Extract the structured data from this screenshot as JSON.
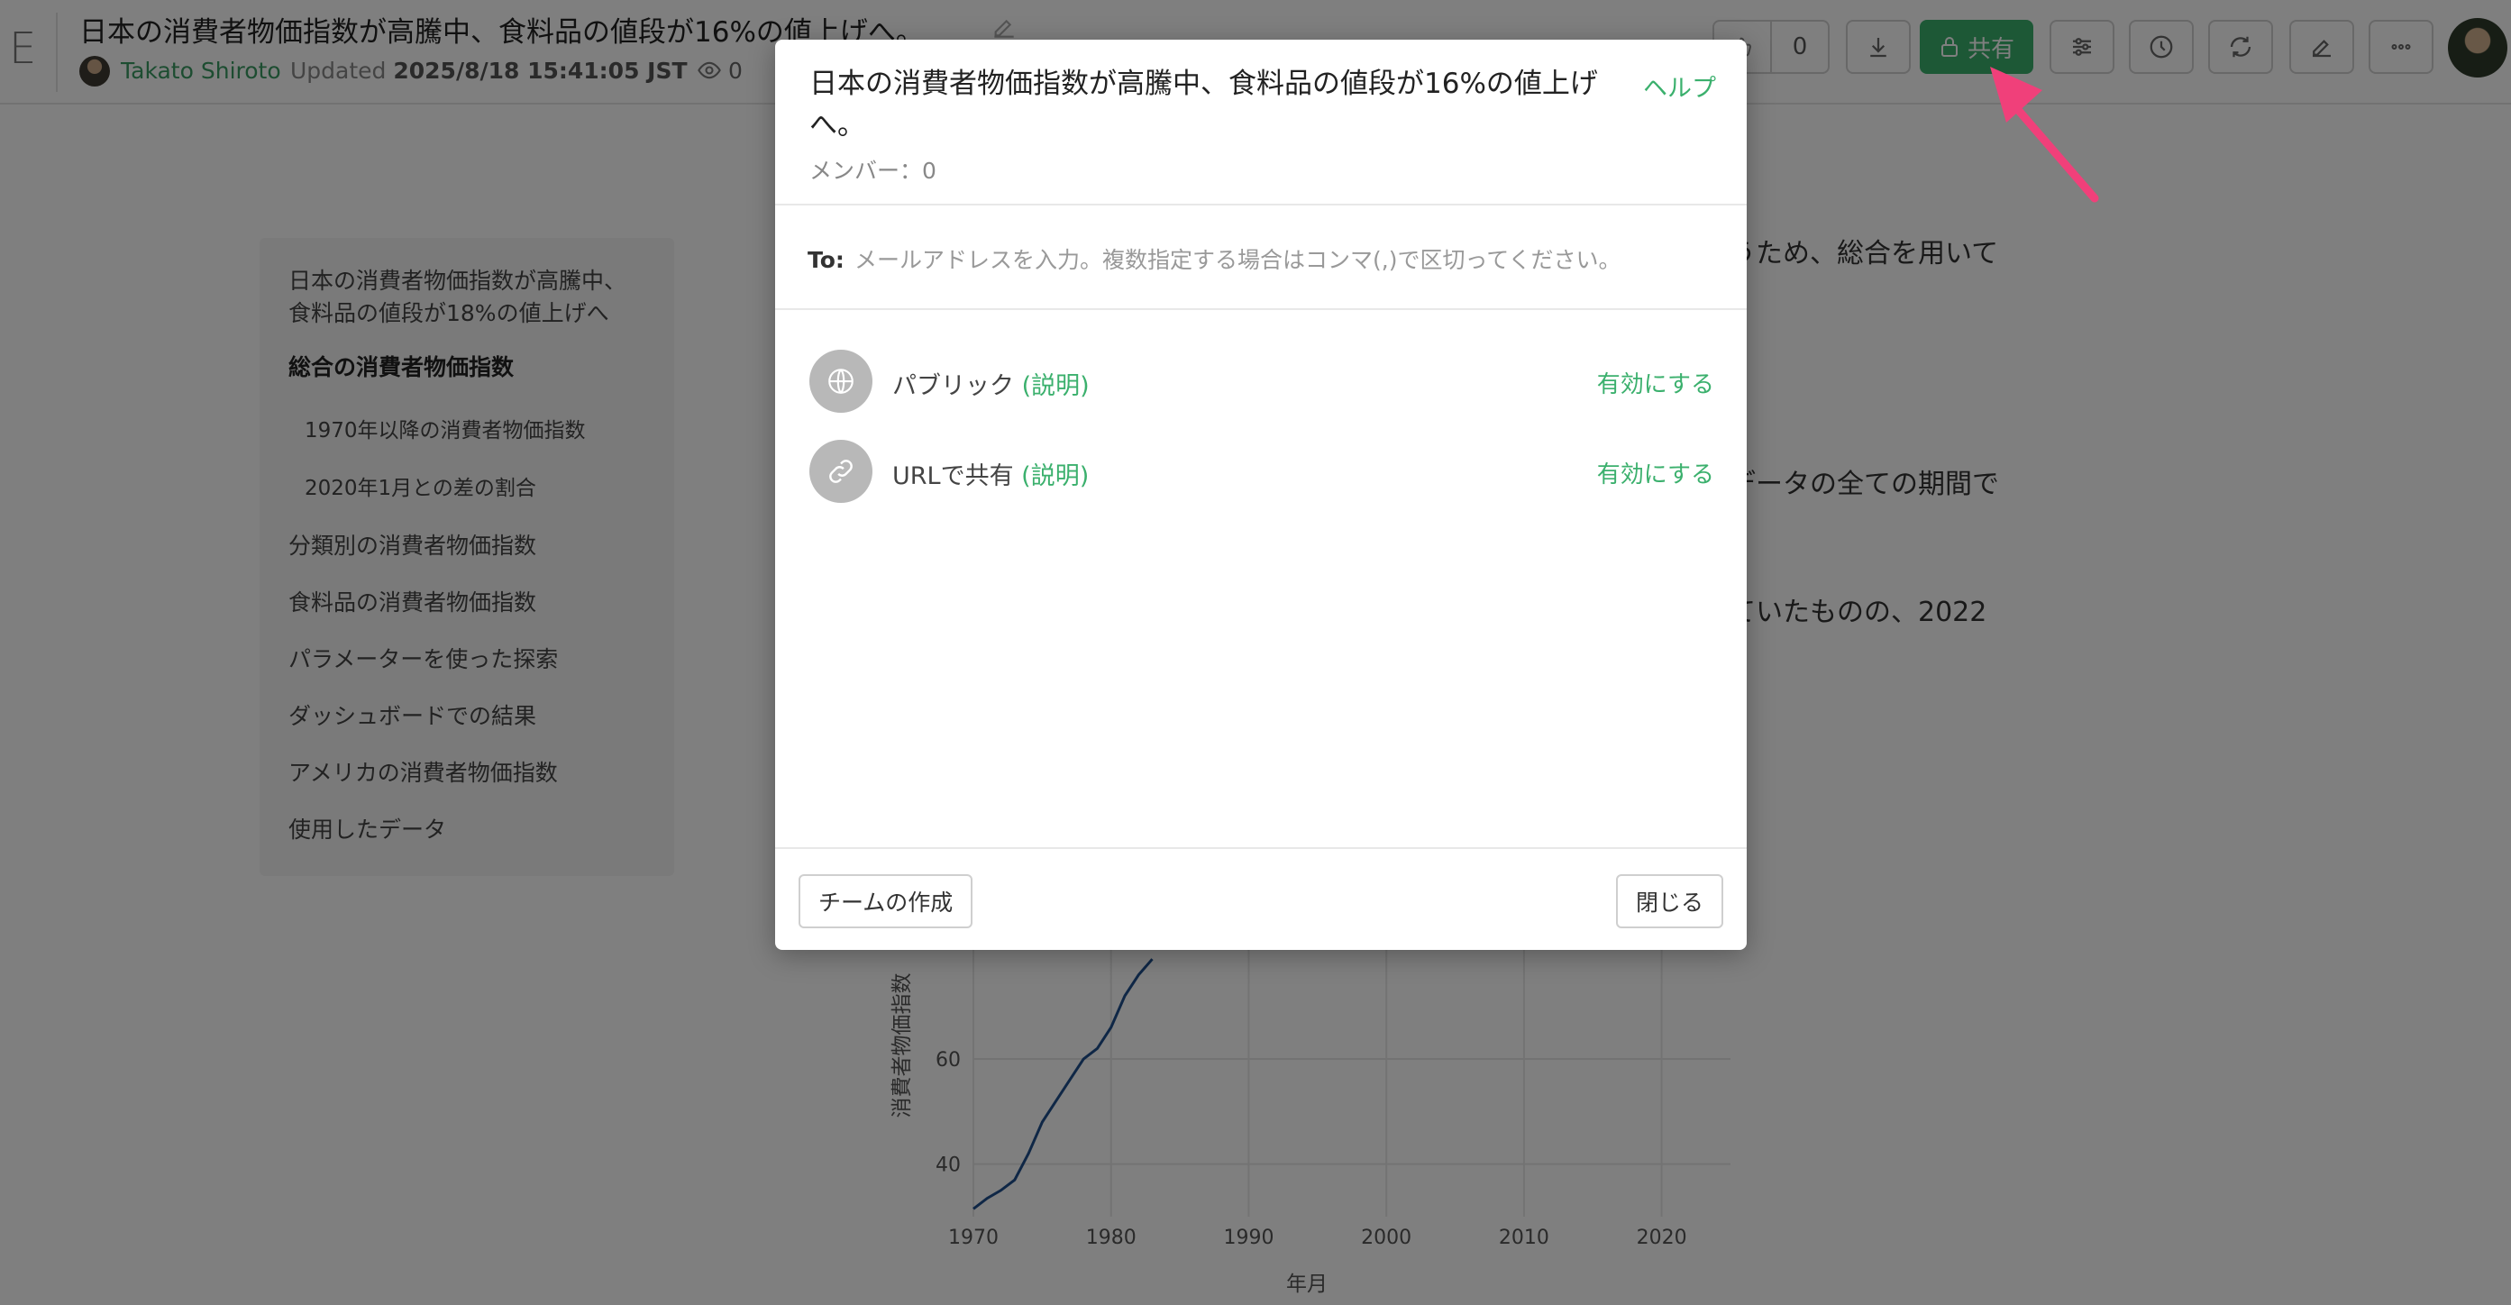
{
  "header": {
    "brand_letter": "E",
    "title": "日本の消費者物価指数が高騰中、食料品の値段が16%の値上げへ。",
    "author": "Takato Shiroto",
    "updated_label": "Updated",
    "updated_value": "2025/8/18 15:41:05 JST",
    "views": "0",
    "likes": "0",
    "share_label": "共有"
  },
  "toc": {
    "items": [
      {
        "label": "日本の消費者物価指数が高騰中、食料品の値段が18%の値上げへ",
        "style": "first"
      },
      {
        "label": "総合の消費者物価指数",
        "style": "bold"
      },
      {
        "label": "1970年以降の消費者物価指数",
        "style": "sub"
      },
      {
        "label": "2020年1月との差の割合",
        "style": "sub"
      },
      {
        "label": "分類別の消費者物価指数",
        "style": ""
      },
      {
        "label": "食料品の消費者物価指数",
        "style": ""
      },
      {
        "label": "パラメーターを使った探索",
        "style": ""
      },
      {
        "label": "ダッシュボードでの結果",
        "style": ""
      },
      {
        "label": "アメリカの消費者物価指数",
        "style": ""
      },
      {
        "label": "使用したデータ",
        "style": ""
      }
    ]
  },
  "body": {
    "line1": "うため、総合を用いて",
    "line2": "データの全ての期間で",
    "line3": "ていたものの、2022"
  },
  "chart_data": {
    "type": "line",
    "xlabel": "年月",
    "ylabel": "消費者物価指数",
    "x_ticks": [
      "1970",
      "1980",
      "1990",
      "2000",
      "2010",
      "2020"
    ],
    "y_ticks": [
      "40",
      "60"
    ],
    "xlim": [
      1970,
      2025
    ],
    "ylim": [
      30,
      90
    ],
    "series": [
      {
        "color": "#1f4e8c",
        "x": [
          1970,
          1971,
          1972,
          1973,
          1974,
          1975,
          1976,
          1977,
          1978,
          1979,
          1980,
          1981,
          1982,
          1983
        ],
        "values": [
          31.5,
          33.5,
          35,
          37,
          42,
          48,
          52,
          56,
          60,
          62,
          66,
          72,
          76,
          79
        ]
      }
    ]
  },
  "modal": {
    "title": "日本の消費者物価指数が高騰中、食料品の値段が16%の値上げへ。",
    "help": "ヘルプ",
    "members": "メンバー：0",
    "to_label": "To:",
    "to_placeholder": "メールアドレスを入力。複数指定する場合はコンマ(,)で区切ってください。",
    "options": [
      {
        "label": "パブリック",
        "explain": "(説明)",
        "enable": "有効にする",
        "icon": "globe-icon"
      },
      {
        "label": "URLで共有",
        "explain": "(説明)",
        "enable": "有効にする",
        "icon": "link-icon"
      }
    ],
    "create_team": "チームの作成",
    "close": "閉じる"
  },
  "colors": {
    "accent": "#3bb06d",
    "annotation_arrow": "#f0407a"
  }
}
